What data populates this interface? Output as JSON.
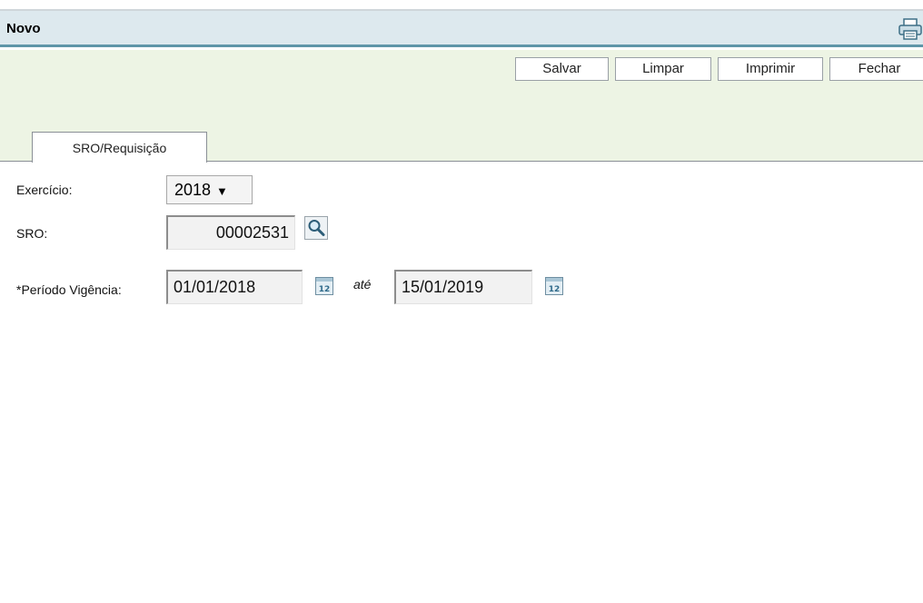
{
  "window": {
    "title": "Novo"
  },
  "toolbar": {
    "buttons": [
      {
        "label": "Salvar"
      },
      {
        "label": "Limpar"
      },
      {
        "label": "Imprimir"
      },
      {
        "label": "Fechar"
      }
    ]
  },
  "tabs": [
    {
      "label": "SRO/Requisição"
    }
  ],
  "form": {
    "exercicio": {
      "label": "Exercício:",
      "value": "2018",
      "options": [
        "2018"
      ]
    },
    "sro": {
      "label": "SRO:",
      "value": "00002531"
    },
    "periodo": {
      "label": "*Período Vigência:",
      "start": "01/01/2018",
      "separator": "até",
      "end": "15/01/2019"
    }
  },
  "icons": {
    "print": "printer-icon",
    "search": "magnifier-icon",
    "calendar": "calendar-icon",
    "calendar_day": "12"
  },
  "colors": {
    "title_bar": "#dde9ee",
    "title_border": "#5f96a8",
    "toolbar_bg": "#edf4e4"
  }
}
